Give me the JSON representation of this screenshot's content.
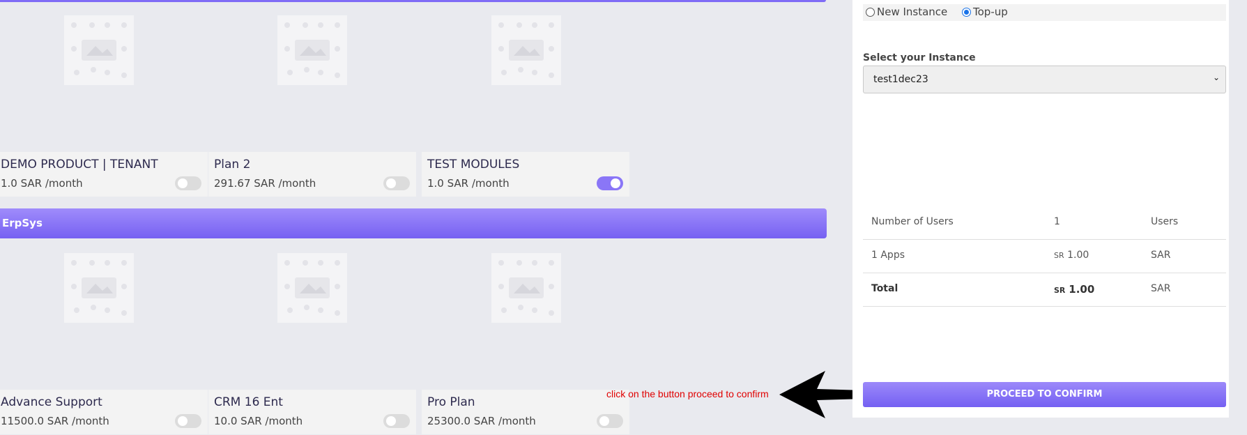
{
  "colors": {
    "accent": "#7f6cf6",
    "annotation": "#e00000",
    "background": "#e9eaef"
  },
  "products_top": [
    {
      "name": "DEMO PRODUCT | TENANT",
      "price": "1.0 SAR /month",
      "toggle_on": false
    },
    {
      "name": "Plan 2",
      "price": "291.67 SAR /month",
      "toggle_on": false
    },
    {
      "name": "TEST MODULES",
      "price": "1.0 SAR /month",
      "toggle_on": true
    }
  ],
  "group": {
    "title": "ErpSys"
  },
  "products_bottom": [
    {
      "name": "Advance Support",
      "price": "11500.0 SAR /month",
      "toggle_on": false
    },
    {
      "name": "CRM 16 Ent",
      "price": "10.0 SAR /month",
      "toggle_on": false
    },
    {
      "name": "Pro Plan",
      "price": "25300.0 SAR /month",
      "toggle_on": false
    }
  ],
  "instance_type": {
    "options": [
      "New Instance",
      "Top-up"
    ],
    "selected": "Top-up"
  },
  "instance_select": {
    "label": "Select your Instance",
    "value": "test1dec23"
  },
  "summary": {
    "rows": [
      {
        "label": "Number of Users",
        "value": "1",
        "unit": "Users"
      },
      {
        "label": "1 Apps",
        "currency": "SR",
        "value": "1.00",
        "unit": "SAR"
      },
      {
        "label": "Total",
        "currency": "SR",
        "value": "1.00",
        "unit": "SAR"
      }
    ]
  },
  "proceed_button": {
    "label": "PROCEED TO CONFIRM"
  },
  "annotation": {
    "text": "click on the button proceed to confirm"
  },
  "icons": [
    "image-placeholder-icon",
    "toggle-switch-icon",
    "chevron-down-icon",
    "arrow-left-icon"
  ]
}
